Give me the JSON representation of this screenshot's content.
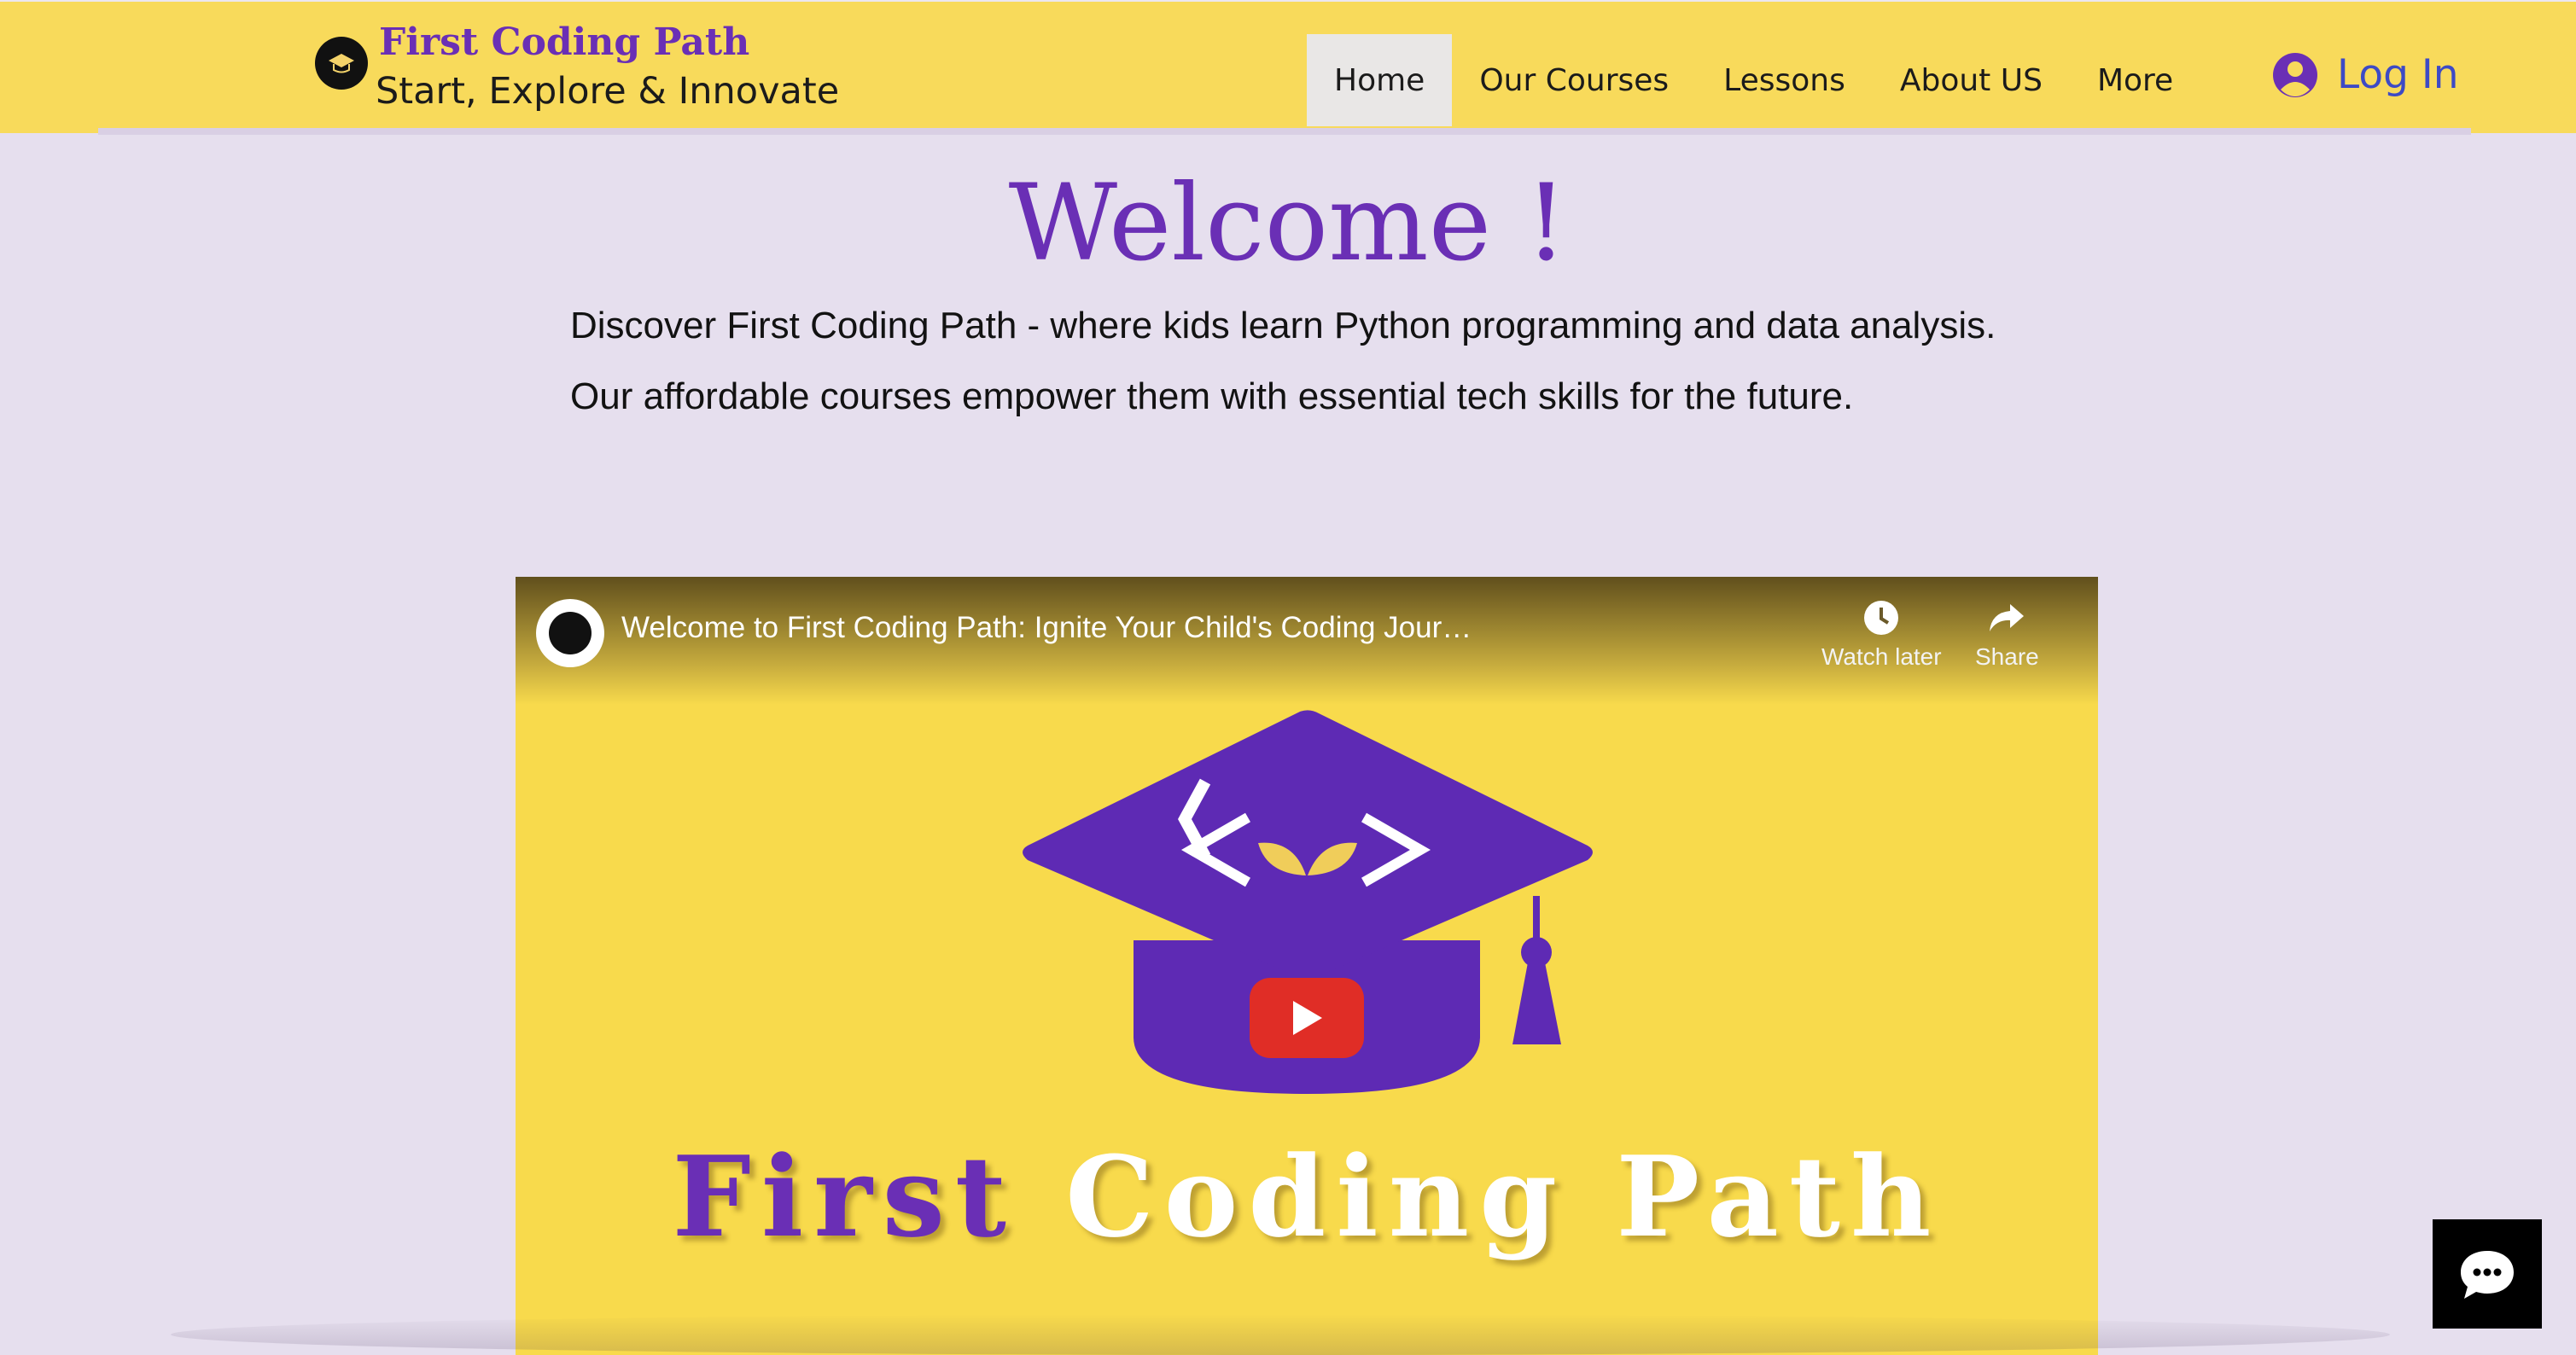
{
  "header": {
    "brand_title": "First Coding Path",
    "brand_tagline": "Start, Explore & Innovate",
    "logo_icon": "graduation-leaf-logo",
    "login_label": "Log In",
    "login_icon": "user-avatar-icon",
    "nav": [
      {
        "label": "Home",
        "active": true
      },
      {
        "label": "Our Courses",
        "active": false
      },
      {
        "label": "Lessons",
        "active": false
      },
      {
        "label": "About US",
        "active": false
      },
      {
        "label": "More",
        "active": false
      }
    ]
  },
  "main": {
    "welcome": "Welcome !",
    "intro": "Discover First Coding Path - where kids learn Python programming and data analysis. Our affordable courses empower them with essential tech skills for the future."
  },
  "video": {
    "title": "Welcome to First Coding Path: Ignite Your Child's Coding Journey! Coding & Data Anal...",
    "watch_later_label": "Watch later",
    "share_label": "Share",
    "thumbnail_word_1": "First",
    "thumbnail_word_2": "Coding Path"
  },
  "colors": {
    "brand_purple": "#6a2fb5",
    "header_yellow": "#f8da5b",
    "page_background": "#e6dfee",
    "login_blue": "#3d4ac5",
    "youtube_red": "#e02d26"
  },
  "chat": {
    "icon": "chat-bubble-icon"
  }
}
